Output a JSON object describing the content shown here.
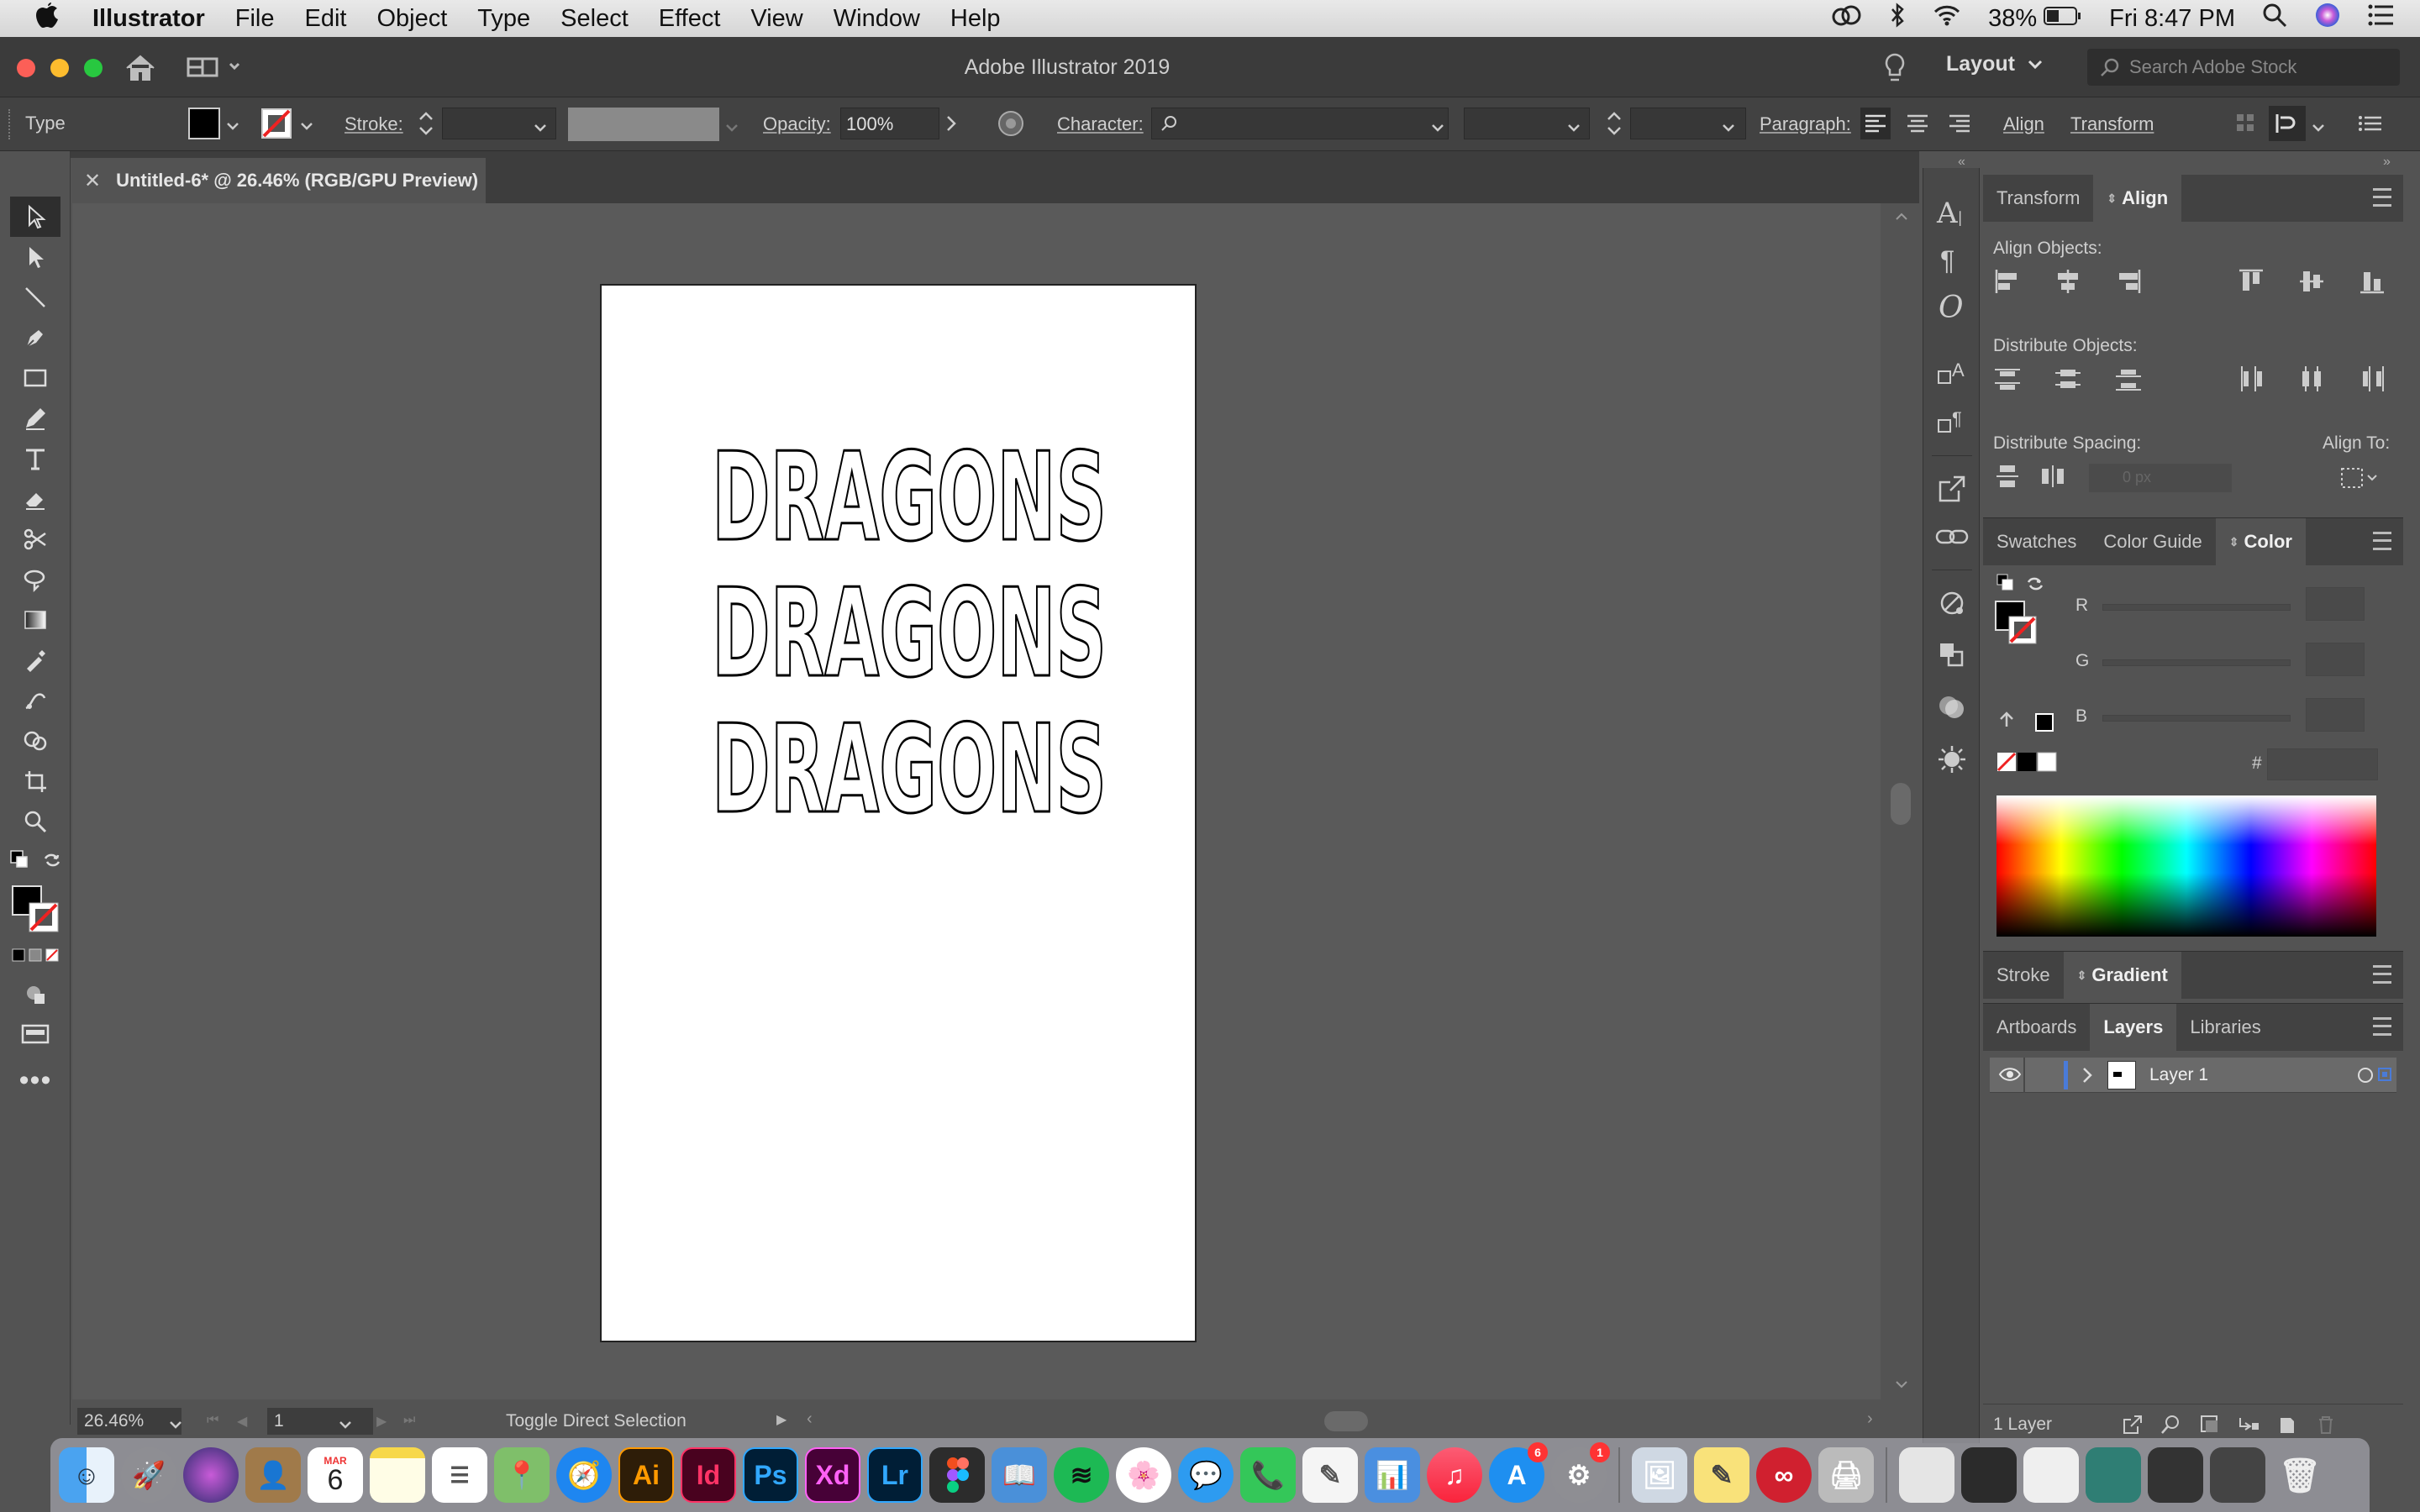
{
  "menubar": {
    "app_name": "Illustrator",
    "items": [
      "File",
      "Edit",
      "Object",
      "Type",
      "Select",
      "Effect",
      "View",
      "Window",
      "Help"
    ],
    "battery": "38%",
    "clock": "Fri 8:47 PM"
  },
  "titlebar": {
    "title": "Adobe Illustrator 2019",
    "workspace": "Layout",
    "search_placeholder": "Search Adobe Stock"
  },
  "control_bar": {
    "tool_label": "Type",
    "stroke_label": "Stroke:",
    "opacity_label": "Opacity:",
    "opacity_value": "100%",
    "character_label": "Character:",
    "paragraph_label": "Paragraph:",
    "align_link": "Align",
    "transform_link": "Transform"
  },
  "document": {
    "tab_title": "Untitled-6* @ 26.46% (RGB/GPU Preview)",
    "artboard_text": [
      "DRAGONS",
      "DRAGONS",
      "DRAGONS"
    ]
  },
  "status_bar": {
    "zoom": "26.46%",
    "artboard_number": "1",
    "status_text": "Toggle Direct Selection"
  },
  "align_panel": {
    "tabs": [
      "Transform",
      "Align"
    ],
    "active_tab": "Align",
    "align_objects_label": "Align Objects:",
    "distribute_objects_label": "Distribute Objects:",
    "distribute_spacing_label": "Distribute Spacing:",
    "align_to_label": "Align To:",
    "spacing_value": "0 px"
  },
  "color_panel": {
    "tabs": [
      "Swatches",
      "Color Guide",
      "Color"
    ],
    "active_tab": "Color",
    "channels": [
      "R",
      "G",
      "B"
    ],
    "hex_label": "#"
  },
  "gradient_panel": {
    "tabs": [
      "Stroke",
      "Gradient"
    ],
    "active_tab": "Gradient"
  },
  "layers_panel": {
    "tabs": [
      "Artboards",
      "Layers",
      "Libraries"
    ],
    "active_tab": "Layers",
    "layer_name": "Layer 1",
    "footer_count": "1 Layer",
    "layer_color": "#4a7bd8"
  },
  "dock": {
    "calendar_month": "MAR",
    "calendar_day": "6",
    "app_store_badge": "6",
    "settings_badge": "1",
    "apps": [
      {
        "label": "Ai",
        "color": "#2e1d08",
        "fg": "#ff9a00"
      },
      {
        "label": "Id",
        "color": "#49021f",
        "fg": "#ff3366"
      },
      {
        "label": "Ps",
        "color": "#001e36",
        "fg": "#31a8ff"
      },
      {
        "label": "Xd",
        "color": "#470137",
        "fg": "#ff61f6"
      },
      {
        "label": "Lr",
        "color": "#001e36",
        "fg": "#31a8ff"
      }
    ]
  }
}
